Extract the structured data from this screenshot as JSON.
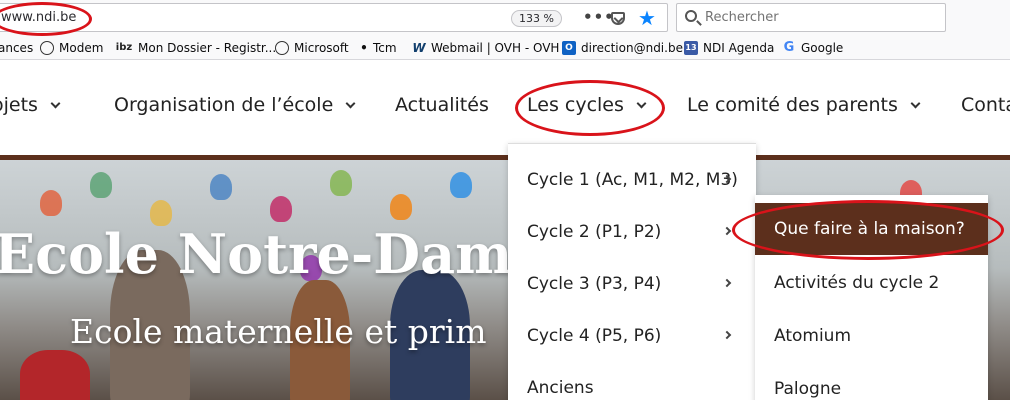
{
  "browser": {
    "url": "www.ndi.be",
    "zoom": "133 %",
    "search_placeholder": "Rechercher",
    "page_actions_glyph": "•••",
    "bookmarks": [
      {
        "label": "ances",
        "icon": "none"
      },
      {
        "label": "Modem",
        "icon": "globe-icon"
      },
      {
        "label": "Mon Dossier - Registr...",
        "icon": "ibz-icon"
      },
      {
        "label": "Microsoft",
        "icon": "globe-icon"
      },
      {
        "label": "Tcm",
        "icon": "tcm-icon"
      },
      {
        "label": "Webmail | OVH - OVH",
        "icon": "ovh-icon"
      },
      {
        "label": "direction@ndi.be",
        "icon": "outlook-icon"
      },
      {
        "label": "NDI Agenda",
        "icon": "calendar-icon"
      },
      {
        "label": "Google",
        "icon": "google-icon"
      }
    ],
    "bookmark_icon_glyphs": {
      "ibz": "ibz",
      "tcm": "•",
      "ovh": "W",
      "outlook": "O",
      "calendar": "13",
      "google": "G"
    }
  },
  "nav": {
    "items": [
      {
        "label": "ojets"
      },
      {
        "label": "Organisation de l’école"
      },
      {
        "label": "Actualités"
      },
      {
        "label": "Les cycles"
      },
      {
        "label": "Le comité des parents"
      },
      {
        "label": "Conta"
      }
    ]
  },
  "hero": {
    "title": "Ecole Notre-Dam",
    "subtitle": "Ecole maternelle et prim"
  },
  "cycles_menu": {
    "items": [
      {
        "label": "Cycle 1 (Ac, M1, M2, M3)"
      },
      {
        "label": "Cycle 2 (P1, P2)"
      },
      {
        "label": "Cycle 3 (P3, P4)"
      },
      {
        "label": "Cycle 4 (P5, P6)"
      },
      {
        "label": "Anciens"
      }
    ]
  },
  "cycle2_submenu": {
    "items": [
      {
        "label": "Que faire à la maison?"
      },
      {
        "label": "Activités du cycle 2"
      },
      {
        "label": "Atomium"
      },
      {
        "label": "Palogne"
      }
    ]
  },
  "colors": {
    "accent_brown": "#5c2f1c",
    "annotation_red": "#d9131a",
    "firefox_blue": "#0a84ff"
  }
}
